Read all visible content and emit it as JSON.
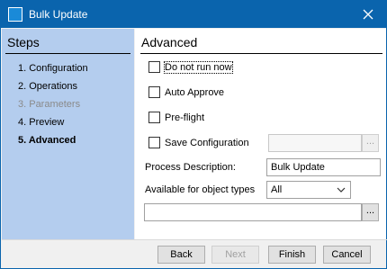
{
  "window": {
    "title": "Bulk Update"
  },
  "steps": {
    "heading": "Steps",
    "items": [
      {
        "label": "1. Configuration",
        "state": "normal"
      },
      {
        "label": "2. Operations",
        "state": "normal"
      },
      {
        "label": "3. Parameters",
        "state": "disabled"
      },
      {
        "label": "4. Preview",
        "state": "normal"
      },
      {
        "label": "5. Advanced",
        "state": "current"
      }
    ]
  },
  "advanced": {
    "heading": "Advanced",
    "do_not_run_now": {
      "label": "Do not run now",
      "checked": false
    },
    "auto_approve": {
      "label": "Auto Approve",
      "checked": false
    },
    "pre_flight": {
      "label": "Pre-flight",
      "checked": false
    },
    "save_configuration": {
      "label": "Save Configuration",
      "checked": false,
      "value": "",
      "browse_label": "..."
    },
    "process_description": {
      "label": "Process Description:",
      "value": "Bulk Update"
    },
    "object_types": {
      "label": "Available for object types",
      "selected": "All"
    },
    "path": {
      "value": "",
      "browse_label": "..."
    }
  },
  "footer": {
    "back": "Back",
    "next": "Next",
    "finish": "Finish",
    "cancel": "Cancel"
  },
  "colors": {
    "titlebar": "#0a64ad",
    "steps_panel": "#b4cdee"
  }
}
